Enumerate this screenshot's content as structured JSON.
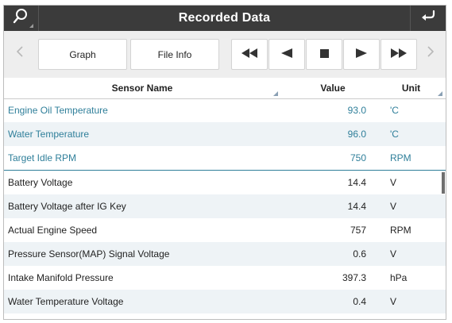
{
  "header": {
    "title": "Recorded Data",
    "left_icon": "search-icon",
    "right_icon": "back-icon"
  },
  "toolbar": {
    "prev_label": "<",
    "graph_label": "Graph",
    "fileinfo_label": "File Info",
    "rewind_label": "◀◀",
    "step_back_label": "◀",
    "stop_label": "■",
    "play_label": "▶",
    "fast_forward_label": "▶▶",
    "next_label": ">"
  },
  "columns": {
    "sensor_name": "Sensor Name",
    "value": "Value",
    "unit": "Unit"
  },
  "rows": [
    {
      "name": "Engine Oil Temperature",
      "value": "93.0",
      "unit": "'C",
      "highlight": true
    },
    {
      "name": "Water Temperature",
      "value": "96.0",
      "unit": "'C",
      "highlight": true
    },
    {
      "name": "Target Idle RPM",
      "value": "750",
      "unit": "RPM",
      "highlight": true
    },
    {
      "name": "Battery Voltage",
      "value": "14.4",
      "unit": "V",
      "highlight": false
    },
    {
      "name": "Battery Voltage after IG Key",
      "value": "14.4",
      "unit": "V",
      "highlight": false
    },
    {
      "name": "Actual Engine Speed",
      "value": "757",
      "unit": "RPM",
      "highlight": false
    },
    {
      "name": "Pressure Sensor(MAP) Signal Voltage",
      "value": "0.6",
      "unit": "V",
      "highlight": false
    },
    {
      "name": "Intake Manifold Pressure",
      "value": "397.3",
      "unit": "hPa",
      "highlight": false
    },
    {
      "name": "Water Temperature Voltage",
      "value": "0.4",
      "unit": "V",
      "highlight": false
    }
  ],
  "colors": {
    "title_bar": "#3b3b3b",
    "highlight_text": "#2f7f9a",
    "alt_row": "#eef3f6"
  }
}
